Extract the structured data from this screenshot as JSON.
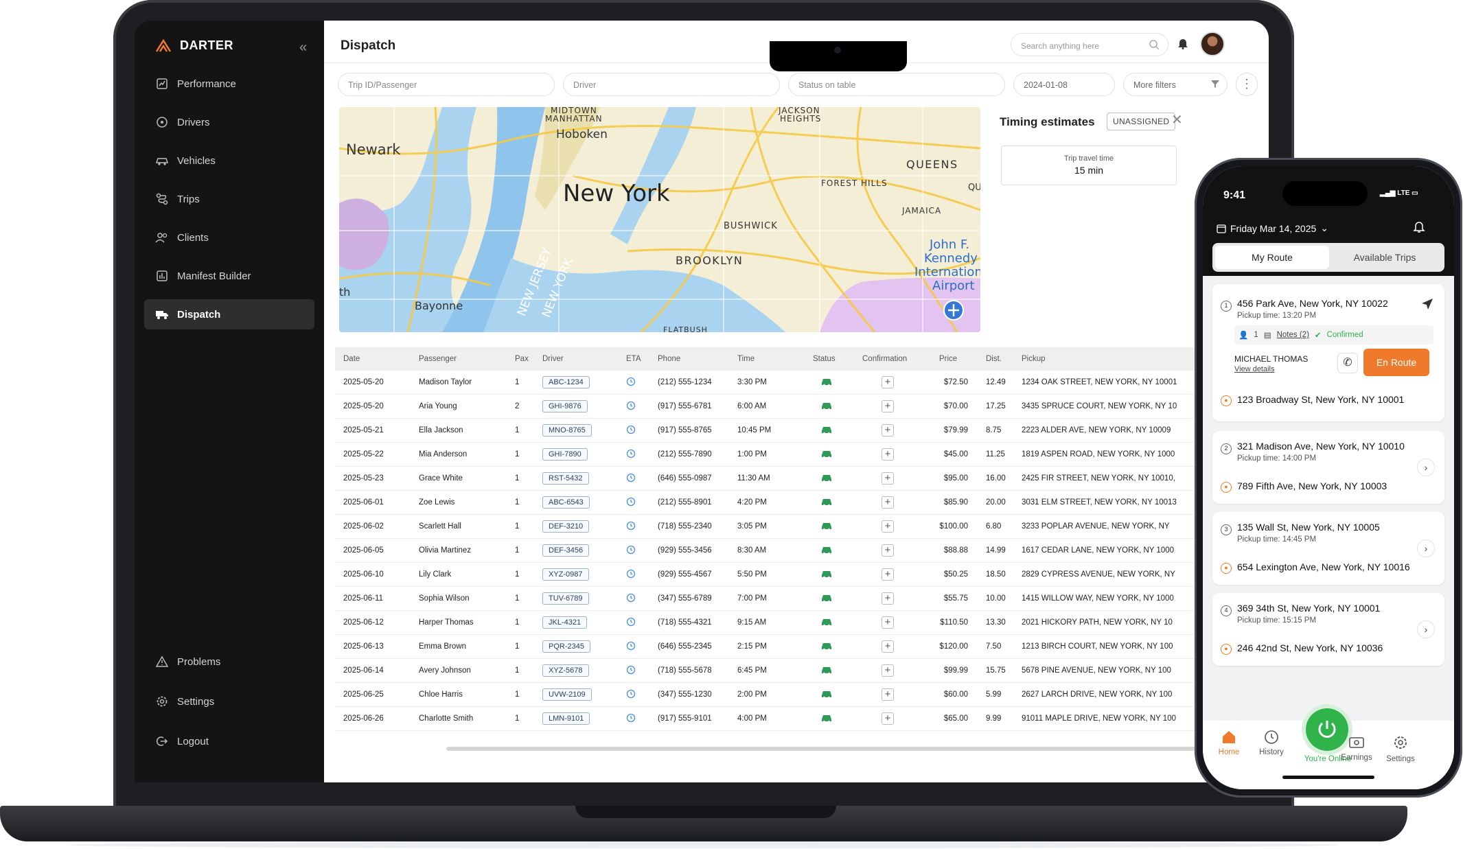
{
  "app": {
    "brand": "DARTER",
    "page_title": "Dispatch"
  },
  "sidebar": {
    "items": [
      {
        "label": "Performance",
        "icon": "performance-icon"
      },
      {
        "label": "Drivers",
        "icon": "driver-icon"
      },
      {
        "label": "Vehicles",
        "icon": "car-icon"
      },
      {
        "label": "Trips",
        "icon": "route-icon"
      },
      {
        "label": "Clients",
        "icon": "users-icon"
      },
      {
        "label": "Manifest Builder",
        "icon": "manifest-icon"
      },
      {
        "label": "Dispatch",
        "icon": "dispatch-icon",
        "active": true
      }
    ],
    "bottom": [
      {
        "label": "Problems",
        "icon": "warning-icon"
      },
      {
        "label": "Settings",
        "icon": "gear-icon"
      },
      {
        "label": "Logout",
        "icon": "logout-icon"
      }
    ]
  },
  "header": {
    "search_placeholder": "Search anything here"
  },
  "filters": {
    "trip": "Trip ID/Passenger",
    "driver": "Driver",
    "status": "Status on table",
    "date": "2024-01-08",
    "more": "More filters"
  },
  "map": {
    "labels": {
      "newark": "Newark",
      "hoboken": "Hoboken",
      "new_york": "New York",
      "queens": "QUEENS",
      "forest_hills": "FOREST HILLS",
      "jamaica": "JAMAICA",
      "bushwick": "BUSHWICK",
      "brooklyn": "BROOKLYN",
      "bayonne": "Bayonne",
      "new_jersey": "NEW JERSEY",
      "new_york_state": "NEW YORK",
      "midtown": "MIDTOWN",
      "manhattan": "MANHATTAN",
      "jackson": "JACKSON",
      "heights": "HEIGHTS",
      "qu": "QU",
      "th": "th",
      "flatbush": "FLATBUSH",
      "jfk_1": "John F.",
      "jfk_2": "Kennedy",
      "jfk_3": "Internation",
      "jfk_4": "Airport"
    }
  },
  "timing": {
    "title": "Timing estimates",
    "badge": "UNASSIGNED",
    "travel_label": "Trip travel time",
    "travel_value": "15 min"
  },
  "table": {
    "headers": [
      "Date",
      "Passenger",
      "Pax",
      "Driver",
      "ETA",
      "Phone",
      "Time",
      "Status",
      "Confirmation",
      "Price",
      "Dist.",
      "Pickup"
    ],
    "rows": [
      [
        "2025-05-20",
        "Madison Taylor",
        "1",
        "ABC-1234",
        "(212) 555-1234",
        "3:30 PM",
        "$72.50",
        "12.49",
        "1234 OAK STREET, NEW YORK, NY 10001"
      ],
      [
        "2025-05-20",
        "Aria Young",
        "2",
        "GHI-9876",
        "(917) 555-6781",
        "6:00 AM",
        "$70.00",
        "17.25",
        "3435 SPRUCE COURT, NEW YORK, NY 10"
      ],
      [
        "2025-05-21",
        "Ella Jackson",
        "1",
        "MNO-8765",
        "(917) 555-8765",
        "10:45 PM",
        "$79.99",
        "8.75",
        "2223 ALDER AVE, NEW YORK, NY 10009"
      ],
      [
        "2025-05-22",
        "Mia Anderson",
        "1",
        "GHI-7890",
        "(212) 555-7890",
        "1:00 PM",
        "$45.00",
        "11.25",
        "1819 ASPEN ROAD, NEW YORK, NY 1000"
      ],
      [
        "2025-05-23",
        "Grace White",
        "1",
        "RST-5432",
        "(646) 555-0987",
        "11:30 AM",
        "$95.00",
        "16.00",
        "2425 FIR STREET, NEW YORK, NY 10010,"
      ],
      [
        "2025-06-01",
        "Zoe Lewis",
        "1",
        "ABC-6543",
        "(212) 555-8901",
        "4:20 PM",
        "$85.90",
        "20.00",
        "3031 ELM STREET, NEW YORK, NY 10013"
      ],
      [
        "2025-06-02",
        "Scarlett Hall",
        "1",
        "DEF-3210",
        "(718) 555-2340",
        "3:05 PM",
        "$100.00",
        "6.80",
        "3233 POPLAR AVENUE, NEW YORK, NY"
      ],
      [
        "2025-06-05",
        "Olivia Martinez",
        "1",
        "DEF-3456",
        "(929) 555-3456",
        "8:30 AM",
        "$88.88",
        "14.99",
        "1617 CEDAR LANE, NEW YORK, NY 1000"
      ],
      [
        "2025-06-10",
        "Lily Clark",
        "1",
        "XYZ-0987",
        "(929) 555-4567",
        "5:50 PM",
        "$50.25",
        "18.50",
        "2829 CYPRESS AVENUE, NEW YORK, NY"
      ],
      [
        "2025-06-11",
        "Sophia Wilson",
        "1",
        "TUV-6789",
        "(347) 555-6789",
        "7:00 PM",
        "$55.75",
        "10.00",
        "1415 WILLOW WAY, NEW YORK, NY 1000"
      ],
      [
        "2025-06-12",
        "Harper Thomas",
        "1",
        "JKL-4321",
        "(718) 555-4321",
        "9:15 AM",
        "$110.50",
        "13.30",
        "2021 HICKORY PATH, NEW YORK, NY 10"
      ],
      [
        "2025-06-13",
        "Emma Brown",
        "1",
        "PQR-2345",
        "(646) 555-2345",
        "2:15 PM",
        "$120.00",
        "7.50",
        "1213 BIRCH COURT, NEW YORK, NY 100"
      ],
      [
        "2025-06-14",
        "Avery Johnson",
        "1",
        "XYZ-5678",
        "(718) 555-5678",
        "6:45 PM",
        "$99.99",
        "15.75",
        "5678 PINE AVENUE, NEW YORK, NY 100"
      ],
      [
        "2025-06-25",
        "Chloe Harris",
        "1",
        "UVW-2109",
        "(347) 555-1230",
        "2:00 PM",
        "$60.00",
        "5.99",
        "2627 LARCH DRIVE, NEW YORK, NY 100"
      ],
      [
        "2025-06-26",
        "Charlotte Smith",
        "1",
        "LMN-9101",
        "(917) 555-9101",
        "4:00 PM",
        "$65.00",
        "9.99",
        "91011 MAPLE DRIVE, NEW YORK, NY 100"
      ]
    ]
  },
  "phone": {
    "time": "9:41",
    "status": "LTE",
    "date": "Friday Mar 14, 2025",
    "tabs": [
      "My Route",
      "Available Trips"
    ],
    "card1": {
      "num": "1",
      "addr": "456 Park Ave, New York, NY 10022",
      "pickup": "Pickup time: 13:20 PM",
      "pax": "1",
      "notes": "Notes (2)",
      "confirmed": "Confirmed",
      "driver": "MICHAEL THOMAS",
      "details": "View details",
      "button": "En Route",
      "dest": "123 Broadway St, New York, NY 10001"
    },
    "cards": [
      {
        "num": "2",
        "addr": "321 Madison Ave, New York, NY 10010",
        "pickup": "Pickup time: 14:00 PM",
        "dest": "789 Fifth Ave, New York, NY 10003"
      },
      {
        "num": "3",
        "addr": "135 Wall St, New York, NY 10005",
        "pickup": "Pickup time: 14:45 PM",
        "dest": "654 Lexington Ave, New York, NY 10016"
      },
      {
        "num": "4",
        "addr": "369 34th St, New York, NY 10001",
        "pickup": "Pickup time: 15:15 PM",
        "dest": "246 42nd St, New York, NY 10036"
      }
    ],
    "nav": [
      "Home",
      "History",
      "You're Online",
      "Earnings",
      "Settings"
    ]
  },
  "colors": {
    "accent": "#f07a2c",
    "online": "#2fb34a",
    "sidebar": "#141414"
  }
}
